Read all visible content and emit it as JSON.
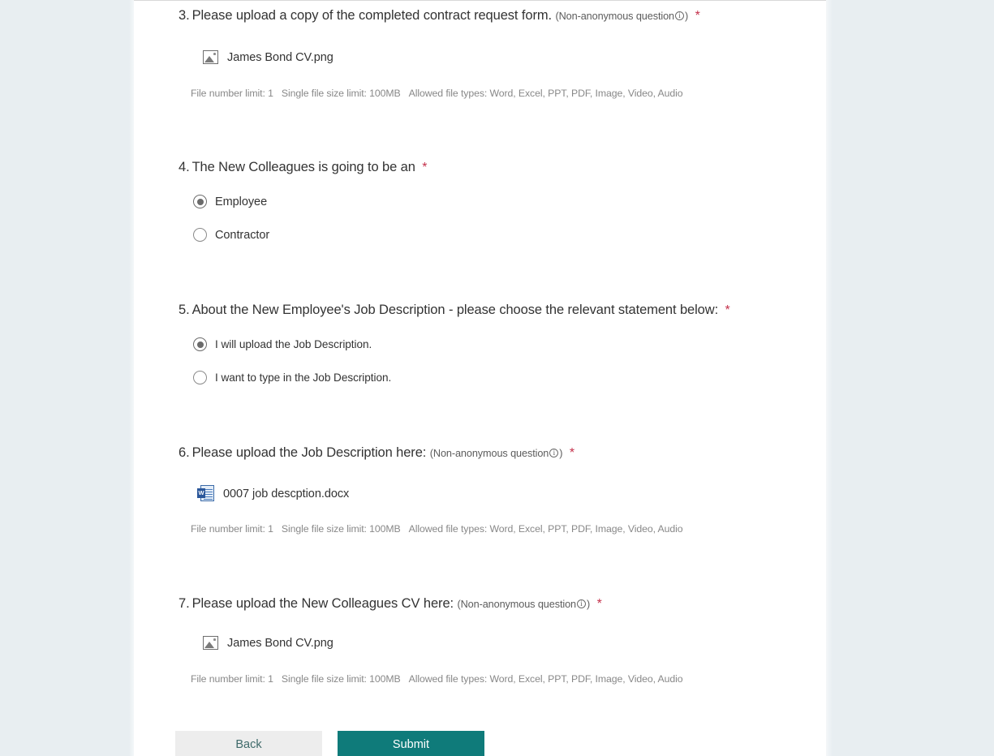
{
  "form": {
    "non_anonymous_note": "(Non-anonymous question",
    "non_anonymous_close": ")",
    "required_mark": "*",
    "limits": {
      "file_number": "File number limit: 1",
      "file_size": "Single file size limit: 100MB",
      "file_types": "Allowed file types: Word, Excel, PPT, PDF, Image, Video, Audio"
    },
    "questions": [
      {
        "number": "3.",
        "title": "Please upload a copy of the completed contract request form.",
        "has_non_anonymous_note": true,
        "required": true,
        "type": "file-upload",
        "attachment": {
          "name": "James Bond CV.png",
          "icon": "image-file-icon"
        }
      },
      {
        "number": "4.",
        "title": "The New Colleagues is going to be an",
        "has_non_anonymous_note": false,
        "required": true,
        "type": "radio",
        "options": [
          {
            "label": "Employee",
            "selected": true
          },
          {
            "label": "Contractor",
            "selected": false
          }
        ]
      },
      {
        "number": "5.",
        "title": "About the New Employee's Job Description - please choose the relevant statement below:",
        "has_non_anonymous_note": false,
        "required": true,
        "type": "radio",
        "options": [
          {
            "label": "I will upload the Job Description.",
            "selected": true
          },
          {
            "label": "I want to type in the Job Description.",
            "selected": false
          }
        ]
      },
      {
        "number": "6.",
        "title": "Please upload the Job Description here:",
        "has_non_anonymous_note": true,
        "required": true,
        "type": "file-upload",
        "attachment": {
          "name": "0007 job descption.docx",
          "icon": "word-file-icon"
        }
      },
      {
        "number": "7.",
        "title": "Please upload the New Colleagues CV here:",
        "has_non_anonymous_note": true,
        "required": true,
        "type": "file-upload",
        "attachment": {
          "name": "James Bond CV.png",
          "icon": "image-file-icon"
        }
      }
    ],
    "footer": {
      "back_label": "Back",
      "submit_label": "Submit"
    },
    "colors": {
      "page_background": "#e8eef1",
      "card_background": "#ffffff",
      "submit_button": "#0f7b7a",
      "back_button": "#ededed",
      "required_asterisk": "#c4314b",
      "question_text": "#333333",
      "helper_text": "#888888"
    }
  }
}
